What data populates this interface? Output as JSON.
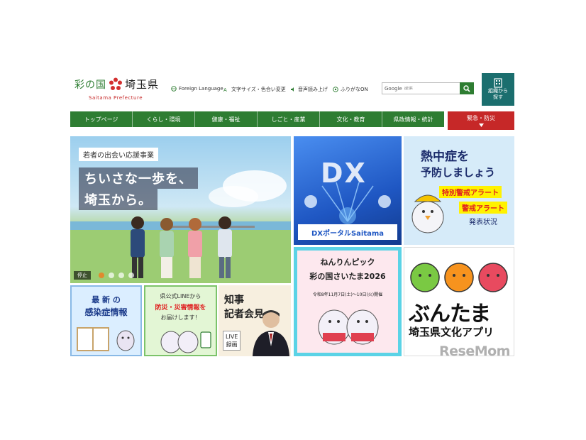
{
  "header": {
    "logo_ja_prefix": "彩の国",
    "logo_ja_name": "埼玉県",
    "logo_en": "Saitama Prefecture",
    "utilities": [
      {
        "label": "Foreign Language",
        "icon": "globe-icon"
      },
      {
        "label": "文字サイズ・色合い変更",
        "icon": "text-size-icon"
      },
      {
        "label": "音声読み上げ",
        "icon": "speaker-icon"
      },
      {
        "label": "ふりがなON",
        "icon": "furigana-icon"
      }
    ],
    "search": {
      "brand": "Google",
      "placeholder": "提供"
    },
    "org_button": {
      "line1": "組織から",
      "line2": "探す",
      "icon": "building-icon"
    }
  },
  "nav": {
    "items": [
      "トップページ",
      "くらし・環境",
      "健康・福祉",
      "しごと・産業",
      "文化・教育",
      "県政情報・統計"
    ],
    "emergency": "緊急・防災"
  },
  "tiles": {
    "hero": {
      "subtitle": "若者の出会い応援事業",
      "line1": "ちいさな一歩を、",
      "line2": "埼玉から。",
      "pause": "停止",
      "slide_count": 4,
      "active_slide": 1
    },
    "dx": {
      "big": "DX",
      "label": "DXポータルSaitama"
    },
    "heatstroke": {
      "line1": "熱中症を",
      "line2": "予防しましょう",
      "alert1": "特別警戒アラート",
      "alert2": "警戒アラート",
      "line3": "発表状況"
    },
    "covid": {
      "line1": "最 新 の",
      "line2": "感染症情報"
    },
    "line": {
      "line1": "県公式LINEから",
      "line2": "防災・災害情報を",
      "line3": "お届けします！"
    },
    "press": {
      "line1": "知事",
      "line2": "記者会見",
      "live1": "LIVE",
      "live2": "録画"
    },
    "nenrin": {
      "line1": "ねんりんピック",
      "line2": "彩の国さいたま2026",
      "dates": "令和8年11月7日(土)〜10日(火)開催"
    },
    "buntama": {
      "line1": "ぶんたま",
      "line2": "埼玉県文化アプリ"
    }
  },
  "watermark": "ReseMom",
  "colors": {
    "nav_green": "#2e7d32",
    "emergency_red": "#c62828",
    "org_teal": "#1b6e6e"
  }
}
